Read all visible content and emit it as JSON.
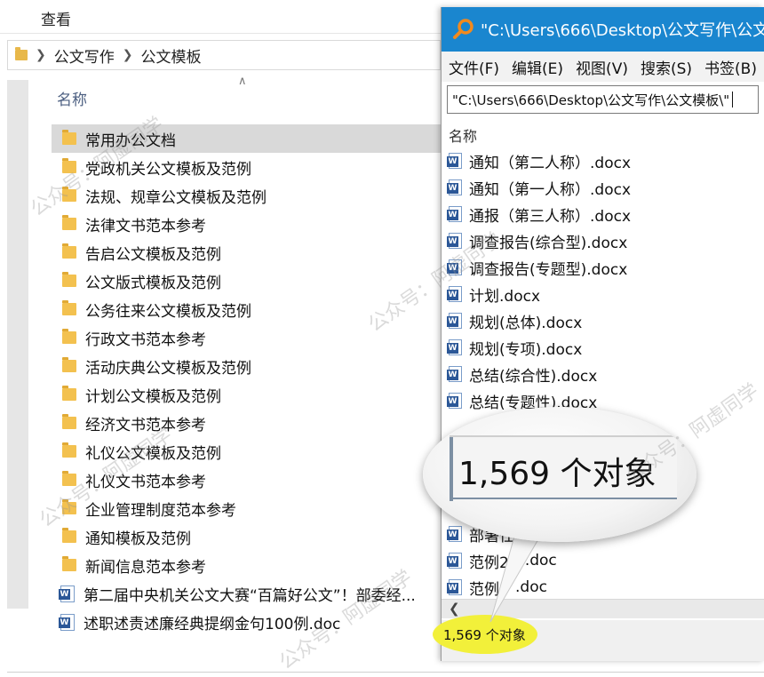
{
  "explorer": {
    "ribbon_tab": "查看",
    "breadcrumb": [
      "公文写作",
      "公文模板"
    ],
    "column_header": "名称",
    "folders": [
      "常用办公文档",
      "党政机关公文模板及范例",
      "法规、规章公文模板及范例",
      "法律文书范本参考",
      "告启公文模板及范例",
      "公文版式模板及范例",
      "公务往来公文模板及范例",
      "行政文书范本参考",
      "活动庆典公文模板及范例",
      "计划公文模板及范例",
      "经济文书范本参考",
      "礼仪公文模板及范例",
      "礼仪文书范本参考",
      "企业管理制度范本参考",
      "通知模板及范例",
      "新闻信息范本参考"
    ],
    "files": [
      "第二届中央机关公文大赛“百篇好公文”！部委经...",
      "述职述责述廉经典提纲金句100例.doc"
    ]
  },
  "everything": {
    "title": "\"C:\\Users\\666\\Desktop\\公文写作\\公文",
    "menu": [
      "文件(F)",
      "编辑(E)",
      "视图(V)",
      "搜索(S)",
      "书签(B)"
    ],
    "search_value": "\"C:\\Users\\666\\Desktop\\公文写作\\公文模板\\\"",
    "column_header": "名称",
    "results": [
      "通知（第二人称）.docx",
      "通知（第一人称）.docx",
      "通报（第三人称）.docx",
      "调查报告(综合型).docx",
      "调查报告(专题型).docx",
      "计划.docx",
      "规划(总体).docx",
      "规划(专项).docx",
      "总结(综合性).docx",
      "总结(专题性).docx"
    ],
    "results_lower": [
      "部署任",
      "范例2",
      "范例"
    ],
    "results_lower_suffix": [
      "",
      ".doc",
      ".doc"
    ],
    "status": "1,569 个对象"
  },
  "callout": {
    "magnified_text": "1,569 个对象",
    "highlight_color": "#f2f03a"
  },
  "watermarks": [
    "公众号：阿虚同学",
    "公众号：阿虚同学",
    "公众号：阿虚同学",
    "公众号：阿虚同学",
    "公众号：阿虚同学"
  ],
  "icons": {
    "folder": "folder-icon",
    "word_doc": "word-document-icon",
    "everything_logo": "everything-search-icon"
  }
}
